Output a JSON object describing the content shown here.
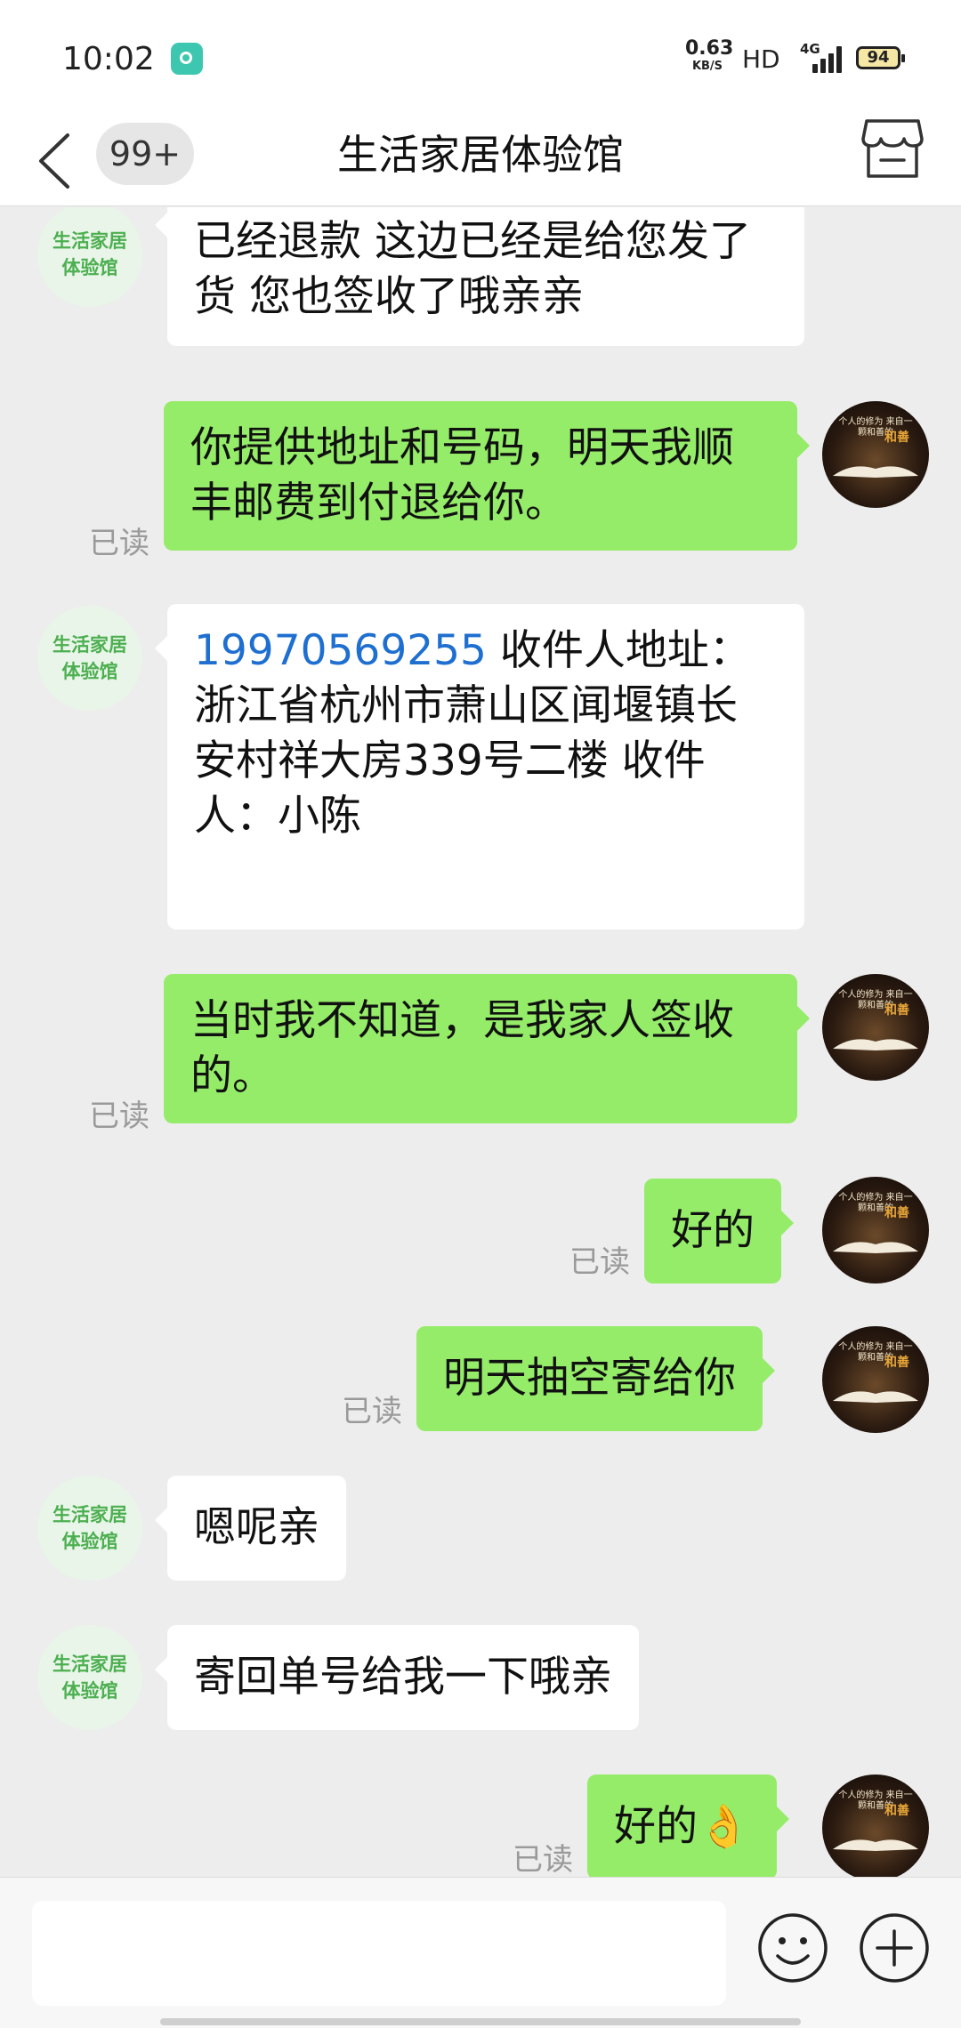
{
  "status_bar": {
    "time": "10:02",
    "net_speed": "0.63",
    "net_speed_unit": "KB/S",
    "hd": "HD",
    "network": "4G",
    "battery": "94"
  },
  "header": {
    "badge": "99+",
    "title": "生活家居体验馆"
  },
  "shop_avatar_text": "生活家居体验馆",
  "user_avatar_text": "个人的修为 来自一颗和善的",
  "user_avatar_highlight": "和善",
  "read_label": "已读",
  "messages": [
    {
      "side": "left",
      "text": "已经退款  这边已经是给您发了货  您也签收了哦亲亲"
    },
    {
      "side": "right",
      "text": "你提供地址和号码，明天我顺丰邮费到付退给你。",
      "status": "已读"
    },
    {
      "side": "left",
      "phone": "19970569255",
      "text": " 收件人地址：浙江省杭州市萧山区闻堰镇长安村祥大房339号二楼 收件人：小陈"
    },
    {
      "side": "right",
      "text": "当时我不知道，是我家人签收的。",
      "status": "已读"
    },
    {
      "side": "right",
      "text": "好的",
      "status": "已读"
    },
    {
      "side": "right",
      "text": "明天抽空寄给你",
      "status": "已读"
    },
    {
      "side": "left",
      "text": "嗯呢亲"
    },
    {
      "side": "left",
      "text": "寄回单号给我一下哦亲"
    },
    {
      "side": "right",
      "text": "好的",
      "emoji": "👌",
      "status": "已读"
    }
  ],
  "input": {
    "value": "",
    "placeholder": ""
  },
  "icons": {
    "back": "back-arrow-icon",
    "store": "store-icon",
    "emoji": "smiley-icon",
    "plus": "plus-icon"
  },
  "colors": {
    "sent_bubble": "#95ec69",
    "received_bubble": "#ffffff",
    "background": "#ededed",
    "phone_link": "#1e6fd0",
    "shop_avatar_text": "#4caf50"
  }
}
